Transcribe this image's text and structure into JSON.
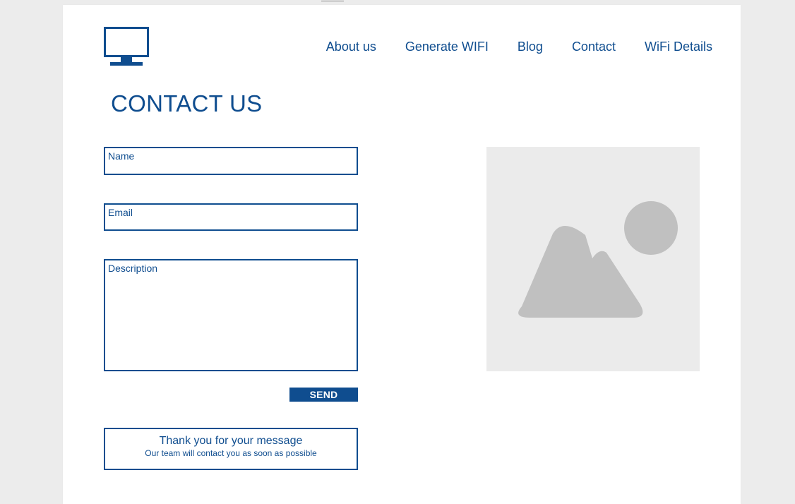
{
  "header": {
    "logo_icon": "monitor-icon",
    "nav": [
      {
        "label": "About us"
      },
      {
        "label": "Generate WIFI"
      },
      {
        "label": "Blog"
      },
      {
        "label": "Contact"
      },
      {
        "label": "WiFi Details"
      }
    ]
  },
  "main": {
    "title": "CONTACT US",
    "form": {
      "name_label": "Name",
      "email_label": "Email",
      "description_label": "Description",
      "name_value": "",
      "email_value": "",
      "description_value": "",
      "send_label": "SEND"
    },
    "confirmation": {
      "title": "Thank you for your message",
      "subtitle": "Our team will contact you as soon as possible"
    },
    "image_icon": "image-placeholder-icon"
  },
  "colors": {
    "brand": "#0f4d8f",
    "page_background": "#ececec",
    "placeholder_background": "#ebebeb",
    "placeholder_shapes": "#c0c0c0"
  }
}
